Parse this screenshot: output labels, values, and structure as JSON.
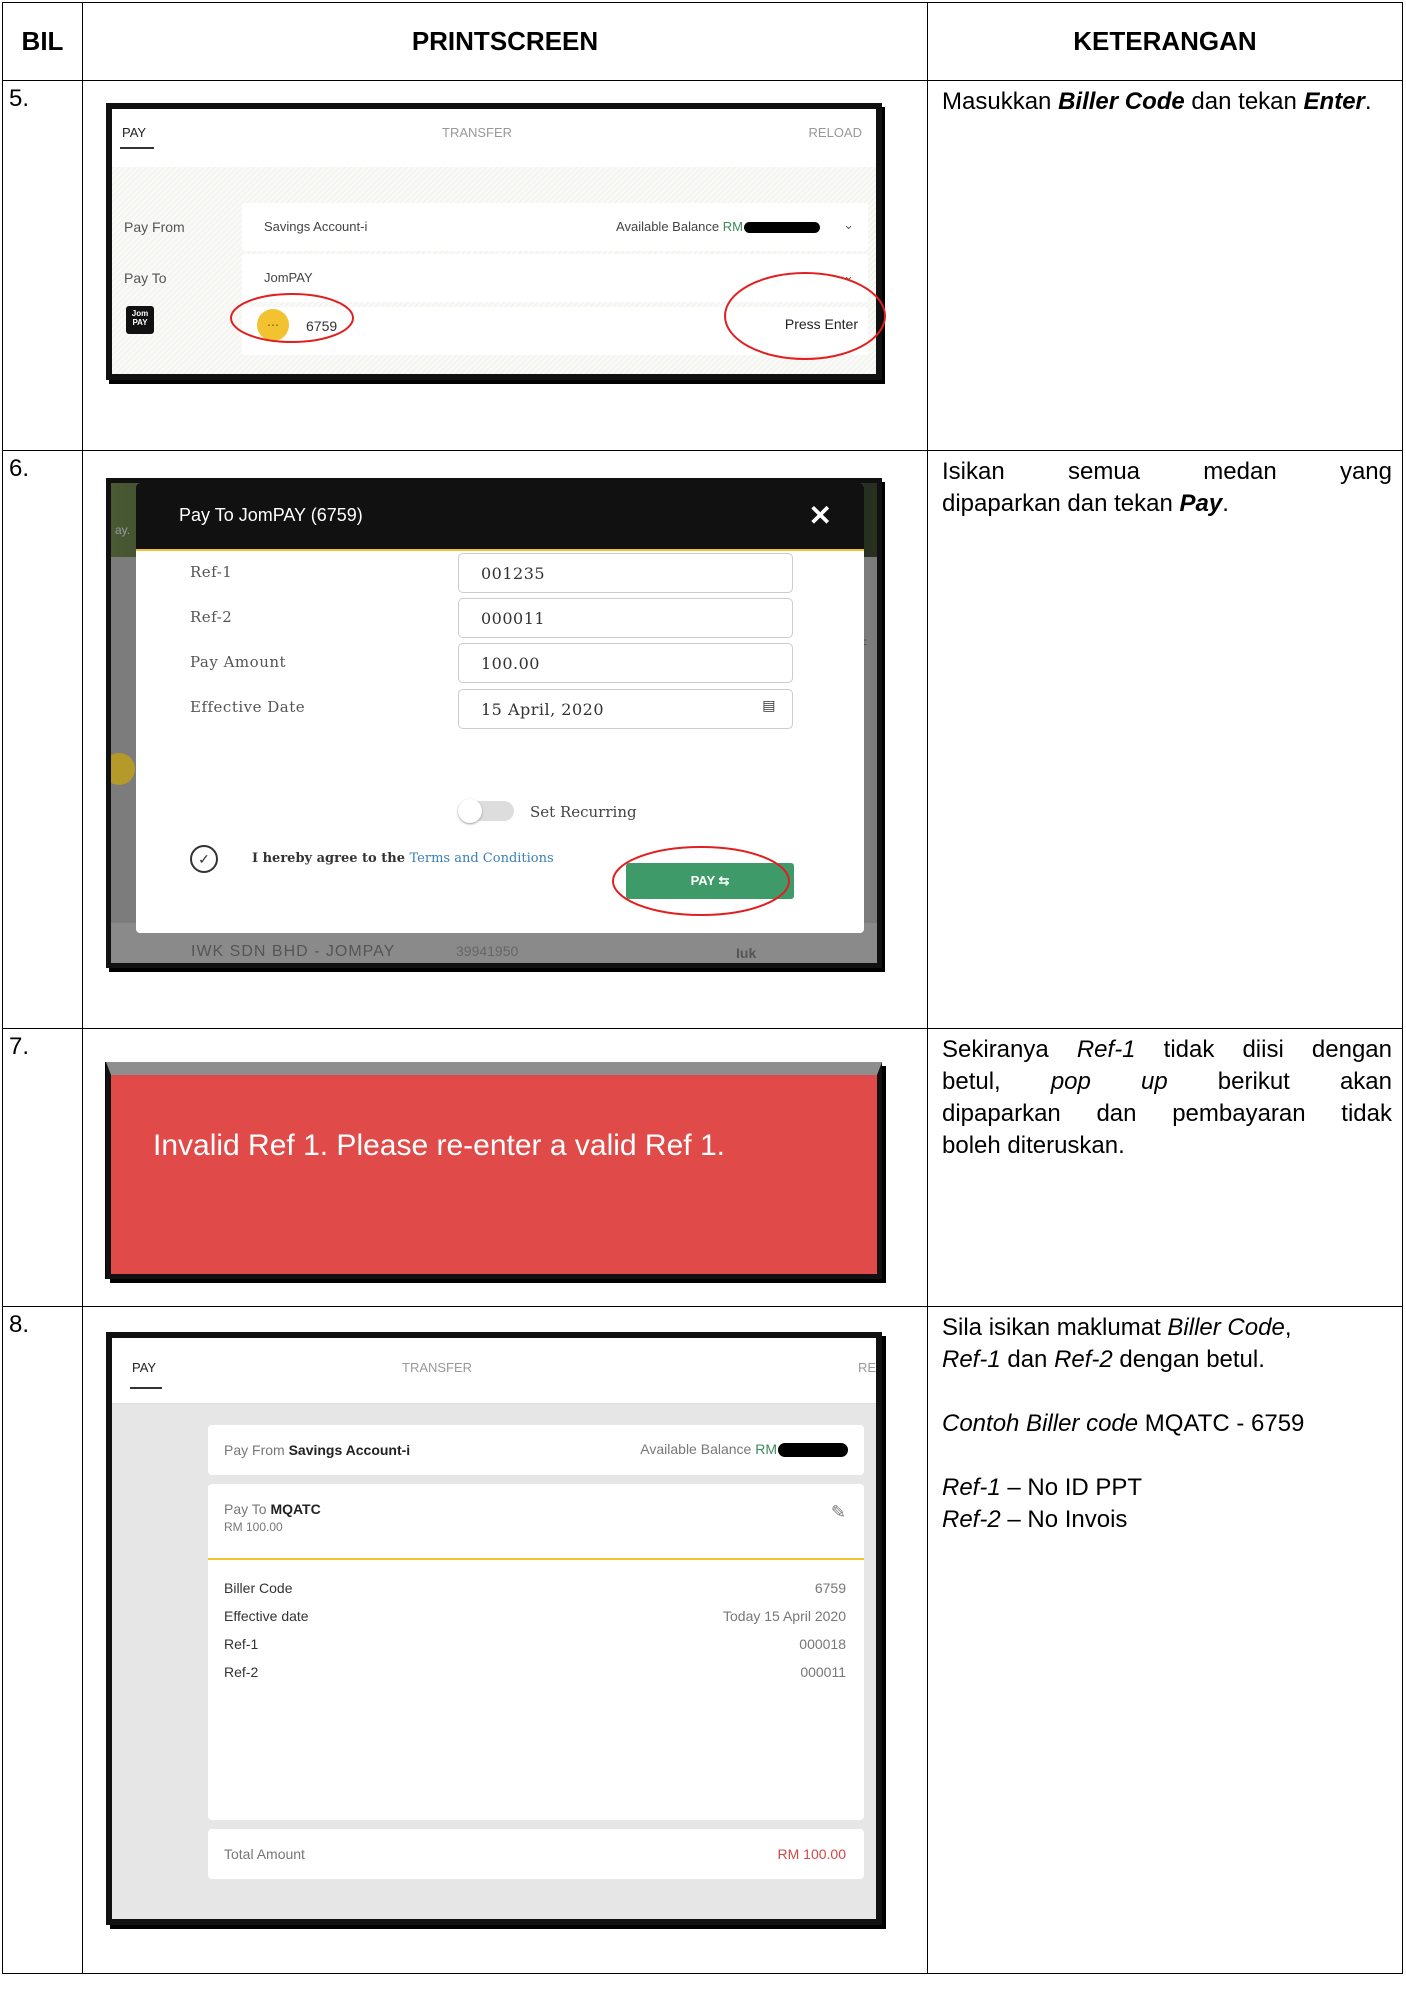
{
  "headers": {
    "bil": "BIL",
    "printscreen": "PRINTSCREEN",
    "keterangan": "KETERANGAN"
  },
  "rows": [
    {
      "num": "5.",
      "screen": {
        "tabs": [
          "PAY",
          "TRANSFER",
          "RELOAD"
        ],
        "pay_from_label": "Pay From",
        "pay_from_value": "Savings Account-i",
        "available_balance": "Available Balance",
        "currency": "RM",
        "pay_to_label": "Pay To",
        "pay_to_value": "JomPAY",
        "logo_text": "Jom PAY",
        "biller_code": "6759",
        "press_enter": "Press Enter"
      },
      "desc": {
        "pre": "Masukkan ",
        "b1": "Biller Code",
        "mid": " dan tekan ",
        "b2": "Enter",
        "post": "."
      }
    },
    {
      "num": "6.",
      "screen": {
        "title": "Pay To JomPAY (6759)",
        "close": "✕",
        "ref1_label": "Ref-1",
        "ref1_value": "001235",
        "ref2_label": "Ref-2",
        "ref2_value": "000011",
        "amount_label": "Pay Amount",
        "amount_value": "100.00",
        "date_label": "Effective Date",
        "date_value": "15 April, 2020",
        "recurring": "Set Recurring",
        "agree": "I hereby agree to the ",
        "terms": "Terms and Conditions",
        "pay_button": "PAY  ⇆",
        "bg_text": "IWK SDN BHD - JOMPAY",
        "bg_number": "39941950",
        "bg_right": "Iuk"
      },
      "desc": {
        "line1": "Isikan semua medan yang",
        "pre": "dipaparkan dan tekan ",
        "b": "Pay",
        "post": "."
      }
    },
    {
      "num": "7.",
      "screen": {
        "message": "Invalid Ref 1. Please re-enter a valid Ref 1."
      },
      "desc": {
        "l1_pre": "Sekiranya ",
        "l1_i": "Ref-1",
        "l1_post": " tidak diisi dengan",
        "l2_pre": "betul, ",
        "l2_i": "pop up",
        "l2_post": " berikut akan",
        "l3": "dipaparkan dan pembayaran tidak",
        "l4": "boleh diteruskan."
      }
    },
    {
      "num": "8.",
      "screen": {
        "tabs": [
          "PAY",
          "TRANSFER",
          "RE"
        ],
        "pay_from_label": "Pay From",
        "pay_from_value": "Savings Account-i",
        "available_balance": "Available Balance",
        "currency": "RM",
        "pay_to_label": "Pay To",
        "pay_to_value": "MQATC",
        "pay_to_amount": "RM 100.00",
        "rows": [
          {
            "label": "Biller Code",
            "value": "6759"
          },
          {
            "label": "Effective date",
            "value": "Today 15 April 2020"
          },
          {
            "label": "Ref-1",
            "value": "000018"
          },
          {
            "label": "Ref-2",
            "value": "000011"
          }
        ],
        "total_label": "Total Amount",
        "total_value": "RM 100.00"
      },
      "desc": {
        "p1_pre": "Sila isikan maklumat ",
        "p1_i1": "Biller Code",
        "p1_c": ",",
        "p1_i2": "Ref-1",
        "p1_mid": " dan ",
        "p1_i3": "Ref-2",
        "p1_post": " dengan betul.",
        "p2_i": "Contoh Biller code",
        "p2_post": " MQATC - 6759",
        "p3_i": "Ref-1",
        "p3_post": " – No ID PPT",
        "p4_i": "Ref-2",
        "p4_post": " – No Invois"
      }
    }
  ]
}
